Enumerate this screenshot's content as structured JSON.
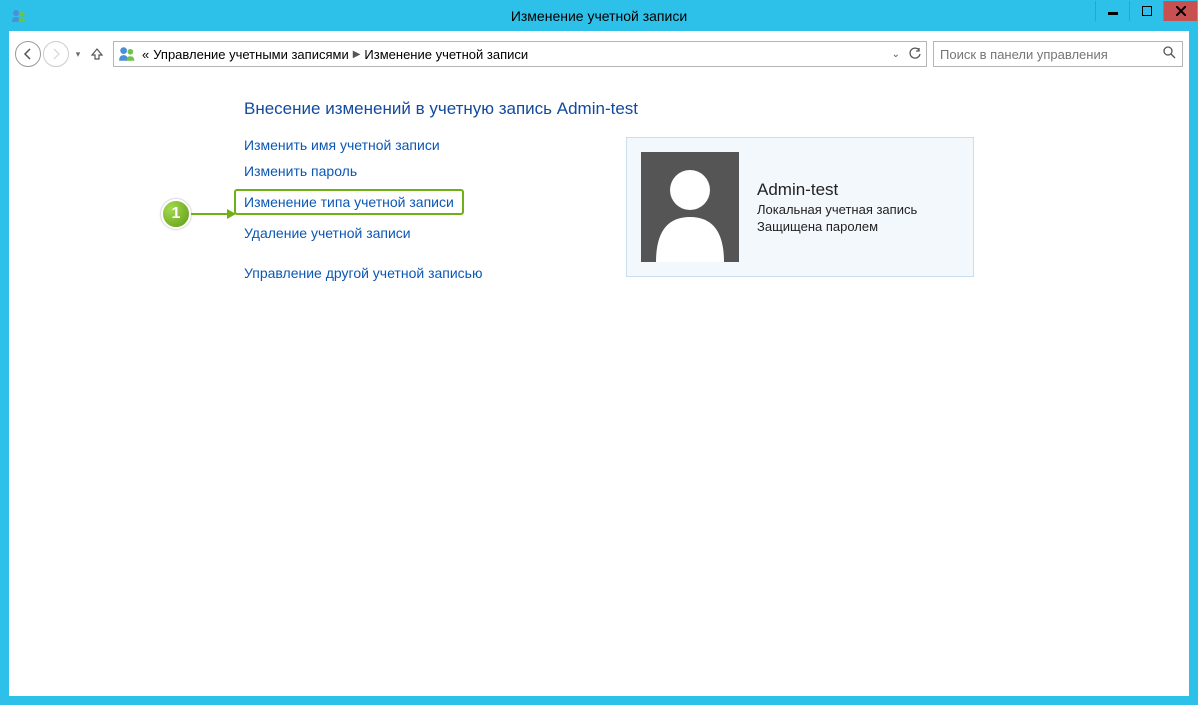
{
  "window": {
    "title": "Изменение учетной записи"
  },
  "breadcrumb": {
    "prefix": "«",
    "item1": "Управление учетными записями",
    "item2": "Изменение учетной записи"
  },
  "search": {
    "placeholder": "Поиск в панели управления"
  },
  "heading": "Внесение изменений в учетную запись Admin-test",
  "links": {
    "rename": "Изменить имя учетной записи",
    "change_password": "Изменить пароль",
    "change_type": "Изменение типа учетной записи",
    "delete": "Удаление учетной записи",
    "manage_other": "Управление другой учетной записью"
  },
  "user": {
    "name": "Admin-test",
    "type": "Локальная учетная запись",
    "protected": "Защищена паролем"
  },
  "annotation": {
    "number": "1"
  }
}
